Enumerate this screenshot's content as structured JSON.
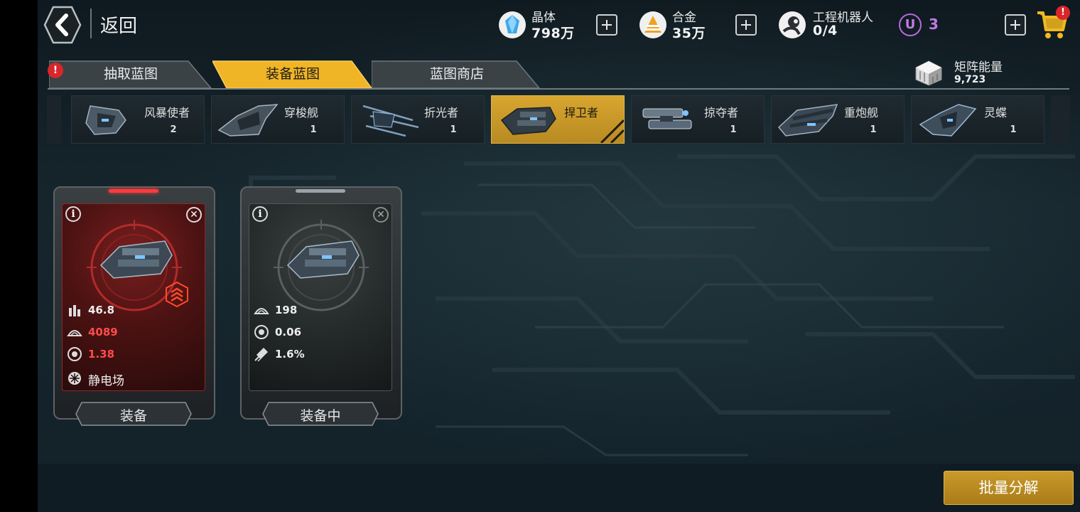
{
  "header": {
    "back_label": "返回",
    "resources": [
      {
        "name": "晶体",
        "value": "798万",
        "icon": "crystal-icon"
      },
      {
        "name": "合金",
        "value": "35万",
        "icon": "alloy-icon"
      },
      {
        "name": "工程机器人",
        "value": "0/4",
        "icon": "robot-icon"
      }
    ],
    "u_currency": {
      "badge": "U",
      "value": "3"
    },
    "cart_alert": "!"
  },
  "tabs": [
    {
      "label": "抽取蓝图",
      "active": false
    },
    {
      "label": "装备蓝图",
      "active": true
    },
    {
      "label": "蓝图商店",
      "active": false
    }
  ],
  "matrix_energy": {
    "label": "矩阵能量",
    "value": "9,723"
  },
  "ships": [
    {
      "name": "风暴使者",
      "count": "2"
    },
    {
      "name": "穿梭舰",
      "count": "1"
    },
    {
      "name": "折光者",
      "count": "1"
    },
    {
      "name": "捍卫者",
      "count": "",
      "selected": true
    },
    {
      "name": "掠夺者",
      "count": "1"
    },
    {
      "name": "重炮舰",
      "count": "1"
    },
    {
      "name": "灵蝶",
      "count": "1"
    }
  ],
  "blueprints": [
    {
      "theme": "red",
      "stats": [
        {
          "icon": "ammo-icon",
          "value": "46.8"
        },
        {
          "icon": "armor-icon",
          "value": "4089"
        },
        {
          "icon": "reactor-icon",
          "value": "1.38"
        },
        {
          "icon": "static-field-icon",
          "value": "静电场"
        }
      ],
      "button": "装备"
    },
    {
      "theme": "grey",
      "stats": [
        {
          "icon": "armor-icon",
          "value": "198"
        },
        {
          "icon": "reactor-icon",
          "value": "0.06"
        },
        {
          "icon": "thruster-icon",
          "value": "1.6%"
        }
      ],
      "button": "装备中"
    }
  ],
  "bulk_button": "批量分解",
  "colors": {
    "accent_gold": "#d8a630",
    "alert_red": "#d8262b",
    "stat_red": "#ff4b4b",
    "u_purple": "#c07ae3"
  }
}
